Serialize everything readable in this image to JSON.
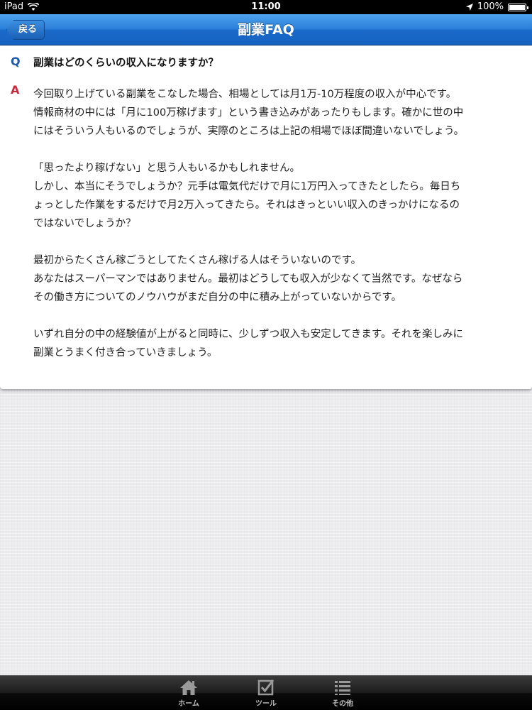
{
  "status_bar": {
    "device": "iPad",
    "time": "11:00",
    "battery": "100%"
  },
  "nav": {
    "back_label": "戻る",
    "title": "副業FAQ"
  },
  "faq": {
    "q_marker": "Q",
    "question": "副業はどのくらいの収入になりますか？",
    "a_marker": "A",
    "paragraphs": [
      [
        "今回取り上げている副業をこなした場合、相場としては月1万-10万程度の収入が中心です。",
        "情報商材の中には「月に100万稼げます」という書き込みがあったりもします。確かに世の中",
        "にはそういう人もいるのでしょうが、実際のところは上記の相場でほぼ間違いないでしょう。"
      ],
      [
        "「思ったより稼げない」と思う人もいるかもしれません。",
        "しかし、本当にそうでしょうか？元手は電気代だけで月に1万円入ってきたとしたら。毎日ち",
        "ょっとした作業をするだけで月2万入ってきたら。それはきっといい収入のきっかけになるの",
        "ではないでしょうか？"
      ],
      [
        "最初からたくさん稼ごうとしてたくさん稼げる人はそういないのです。",
        "あなたはスーパーマンではありません。最初はどうしても収入が少なくて当然です。なぜなら",
        "その働き方についてのノウハウがまだ自分の中に積み上がっていないからです。"
      ],
      [
        "いずれ自分の中の経験値が上がると同時に、少しずつ収入も安定してきます。それを楽しみに",
        "副業とうまく付き合っていきましょう。"
      ]
    ]
  },
  "tab_bar": {
    "items": [
      {
        "label": "ホーム",
        "icon": "home-icon"
      },
      {
        "label": "ツール",
        "icon": "checkbox-icon"
      },
      {
        "label": "その他",
        "icon": "list-icon"
      }
    ]
  }
}
